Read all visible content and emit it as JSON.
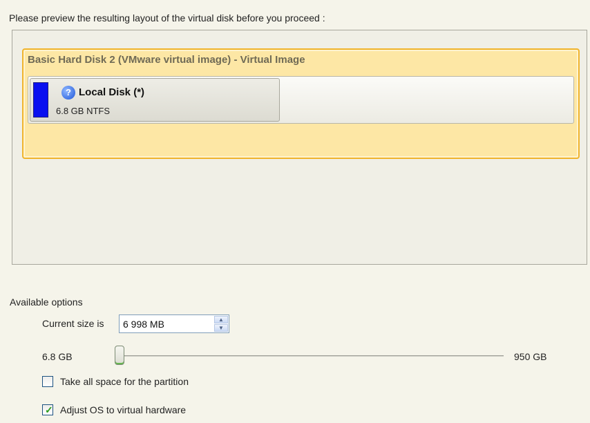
{
  "instruction": "Please preview the resulting layout of the virtual disk before you proceed :",
  "disk": {
    "title": "Basic Hard Disk 2 (VMware virtual image) - Virtual Image",
    "partition": {
      "name": "Local Disk (*)",
      "size_fs": "6.8 GB NTFS",
      "color": "#0a10f0",
      "icon": "help-icon"
    }
  },
  "options": {
    "label": "Available options",
    "current_size_label": "Current size is",
    "current_size_value": "6 998 MB",
    "slider": {
      "min_label": "6.8 GB",
      "max_label": "950 GB",
      "value_fraction": 0.0
    },
    "take_all_space": {
      "label": "Take all space for the partition",
      "checked": false
    },
    "adjust_os": {
      "label": "Adjust OS to virtual hardware",
      "checked": true
    }
  }
}
